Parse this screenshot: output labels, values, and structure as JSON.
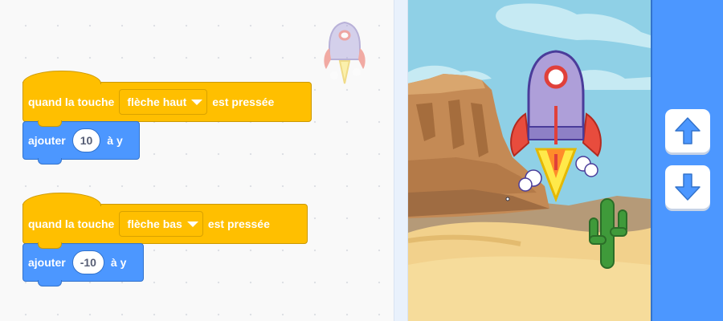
{
  "scripts": [
    {
      "event": {
        "prefix": "quand la touche",
        "key": "flèche haut",
        "suffix": "est pressée"
      },
      "action": {
        "verb": "ajouter",
        "value": "10",
        "suffix": "à y"
      }
    },
    {
      "event": {
        "prefix": "quand la touche",
        "key": "flèche bas",
        "suffix": "est pressée"
      },
      "action": {
        "verb": "ajouter",
        "value": "-10",
        "suffix": "à y"
      }
    }
  ],
  "controls": {
    "up": "arrow-up-icon",
    "down": "arrow-down-icon"
  },
  "colors": {
    "events": "#ffbf00",
    "motion": "#4c97ff",
    "panel": "#4c97ff"
  }
}
